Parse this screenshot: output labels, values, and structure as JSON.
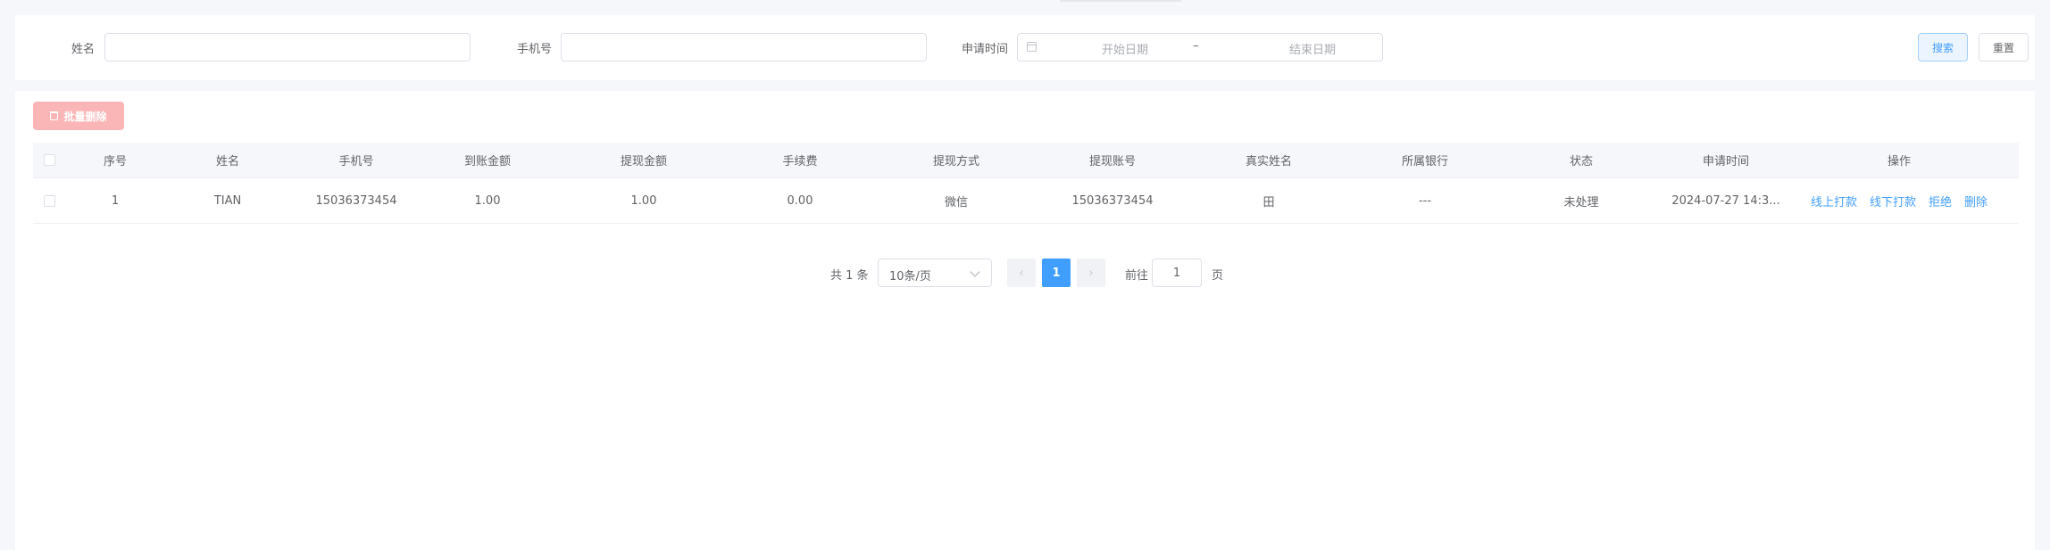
{
  "filters": {
    "name_label": "姓名",
    "name_value": "",
    "phone_label": "手机号",
    "phone_value": "",
    "time_label": "申请时间",
    "date_start_placeholder": "开始日期",
    "date_separator": "–",
    "date_end_placeholder": "结束日期",
    "search_label": "搜索",
    "reset_label": "重置"
  },
  "toolbar": {
    "batch_delete_label": "批量删除",
    "trash_icon": "trash-icon"
  },
  "table": {
    "columns": [
      "序号",
      "姓名",
      "手机号",
      "到账金额",
      "提现金额",
      "手续费",
      "提现方式",
      "提现账号",
      "真实姓名",
      "所属银行",
      "状态",
      "申请时间",
      "操作"
    ],
    "rows": [
      {
        "index": "1",
        "name": "TIAN",
        "phone": "15036373454",
        "received": "1.00",
        "amount": "1.00",
        "fee": "0.00",
        "method": "微信",
        "account": "15036373454",
        "real_name": "田",
        "bank": "---",
        "status": "未处理",
        "time": "2024-07-27 14:3...",
        "actions": [
          "线上打款",
          "线下打款",
          "拒绝",
          "删除"
        ]
      }
    ]
  },
  "pagination": {
    "total": "共 1 条",
    "page_size": "10条/页",
    "current_page": "1",
    "goto_label": "前往",
    "goto_value": "1",
    "page_suffix": "页"
  },
  "colors": {
    "primary": "#409eff",
    "danger_light": "#fab6b6",
    "border": "#dcdfe6"
  }
}
